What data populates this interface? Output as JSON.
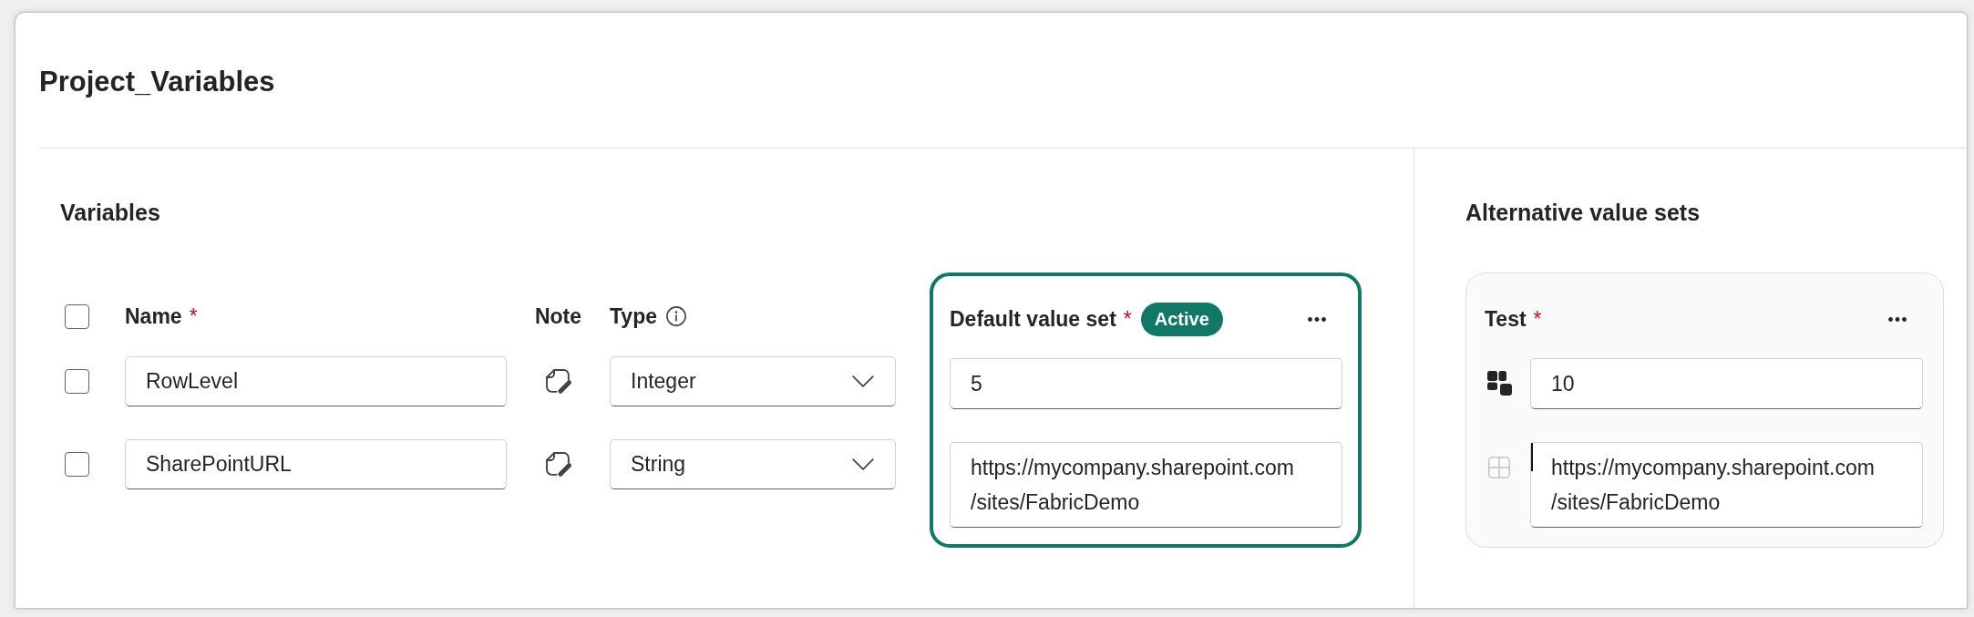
{
  "page": {
    "title": "Project_Variables"
  },
  "variables": {
    "heading": "Variables",
    "header": {
      "checked": false,
      "columns": [
        {
          "kind": "name",
          "label": "Name",
          "required_mark": "*"
        },
        {
          "kind": "note",
          "label": "Note"
        },
        {
          "kind": "type",
          "label": "Type"
        }
      ]
    },
    "rows": [
      {
        "checked": false,
        "name": "RowLevel",
        "type": "Integer"
      },
      {
        "checked": false,
        "name": "SharePointURL",
        "type": "String"
      }
    ]
  },
  "default_value_set": {
    "title": "Default value set",
    "required_mark": "*",
    "badge": "Active",
    "active": true,
    "values": [
      {
        "value": "5"
      },
      {
        "value": "https://mycompany.sharepoint.com/sites/FabricDemo"
      }
    ]
  },
  "alternative_value_sets": {
    "heading": "Alternative value sets",
    "sets": [
      {
        "title": "Test",
        "required_mark": "*",
        "active": false,
        "values": [
          {
            "value": "10",
            "overridden": true,
            "caret": false
          },
          {
            "value": "https://mycompany.sharepoint.com/sites/FabricDemo",
            "overridden": false,
            "caret": true
          }
        ]
      }
    ]
  }
}
